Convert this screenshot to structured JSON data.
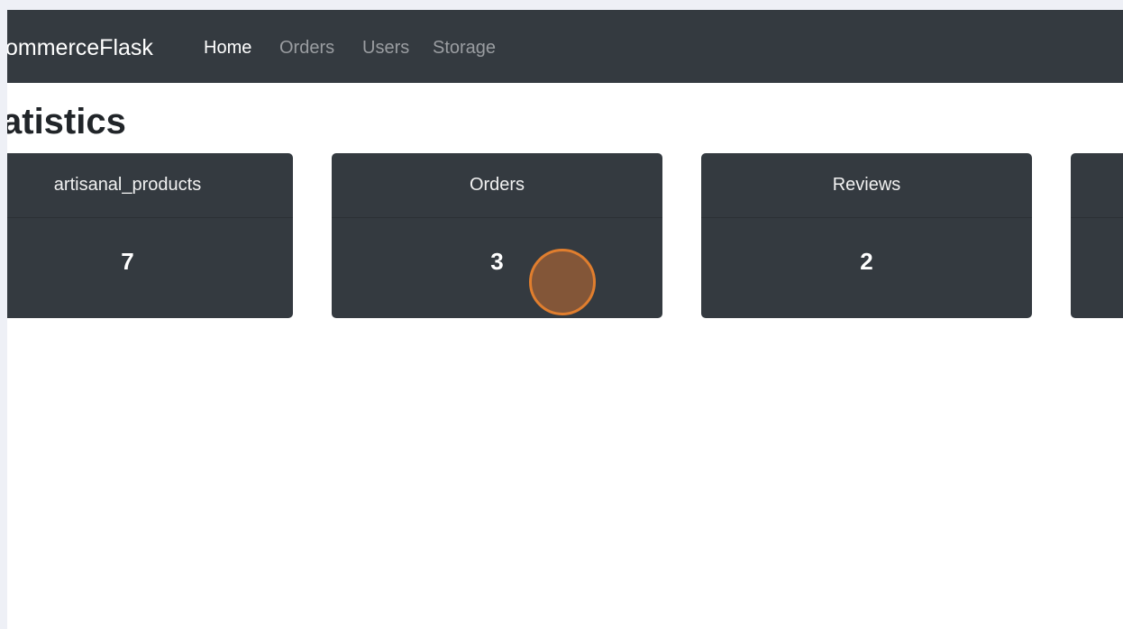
{
  "navbar": {
    "brand": "ommerceFlask",
    "links": [
      {
        "label": "Home",
        "active": true
      },
      {
        "label": "Orders",
        "active": false
      },
      {
        "label": "Users",
        "active": false
      },
      {
        "label": "Storage",
        "active": false
      }
    ]
  },
  "main": {
    "title": "atistics",
    "cards": [
      {
        "label": "artisanal_products",
        "value": "7"
      },
      {
        "label": "Orders",
        "value": "3"
      },
      {
        "label": "Reviews",
        "value": "2"
      },
      {
        "label": "",
        "value": ""
      }
    ]
  },
  "colors": {
    "navbar_bg": "#343a40",
    "card_bg": "#343a40",
    "click_marker": "#e07e2e"
  }
}
